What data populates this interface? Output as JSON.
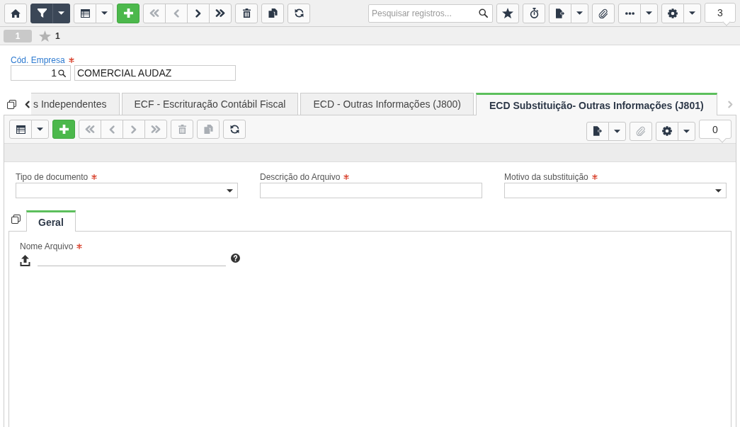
{
  "main_toolbar": {
    "left_buttons": [
      {
        "disabled": false,
        "active": false
      },
      {
        "disabled": false,
        "active": true
      },
      {
        "disabled": false,
        "active": false
      },
      {
        "disabled": false,
        "active": false
      },
      {
        "disabled": true,
        "active": false
      },
      {
        "disabled": true,
        "active": false
      },
      {
        "disabled": false,
        "active": false
      },
      {
        "disabled": false,
        "active": false
      },
      {
        "disabled": false,
        "active": false
      },
      {
        "disabled": false,
        "active": false
      },
      {
        "disabled": false,
        "active": false
      }
    ],
    "search": {
      "placeholder": "Pesquisar registros..."
    },
    "right_buttons": [
      {
        "disabled": false
      },
      {
        "disabled": false
      },
      {
        "disabled": false
      },
      {
        "disabled": false
      },
      {
        "disabled": false
      },
      {
        "disabled": false
      }
    ],
    "record_count": "3"
  },
  "record_bar": {
    "page": "1",
    "favorites": "1"
  },
  "company": {
    "label": "Cód. Empresa",
    "required": true,
    "code": "1",
    "name": "COMERCIAL AUDAZ"
  },
  "tabs": [
    {
      "label": "s Independentes",
      "selected": false
    },
    {
      "label": "ECF - Escrituração Contábil Fiscal",
      "selected": false
    },
    {
      "label": "ECD - Outras Informações (J800)",
      "selected": false
    },
    {
      "label": "ECD Substituição- Outras Informações (J801)",
      "selected": true
    }
  ],
  "detail_toolbar": {
    "left_buttons": [
      {
        "disabled": false
      },
      {
        "disabled": false
      },
      {
        "disabled": true
      },
      {
        "disabled": true
      },
      {
        "disabled": true
      },
      {
        "disabled": true
      },
      {
        "disabled": true
      },
      {
        "disabled": true
      },
      {
        "disabled": false
      }
    ],
    "right_buttons": [
      {
        "disabled": false
      },
      {
        "disabled": true
      },
      {
        "disabled": false
      }
    ],
    "record_count": "0"
  },
  "fields": [
    {
      "label": "Tipo de documento",
      "required": true,
      "kind": "select"
    },
    {
      "label": "Descrição do Arquivo",
      "required": true,
      "kind": "text"
    },
    {
      "label": "Motivo da substituição",
      "required": true,
      "kind": "select"
    }
  ],
  "subtabs": [
    {
      "label": "Geral",
      "selected": true
    }
  ],
  "file_field": {
    "label": "Nome Arquivo",
    "required": true
  }
}
